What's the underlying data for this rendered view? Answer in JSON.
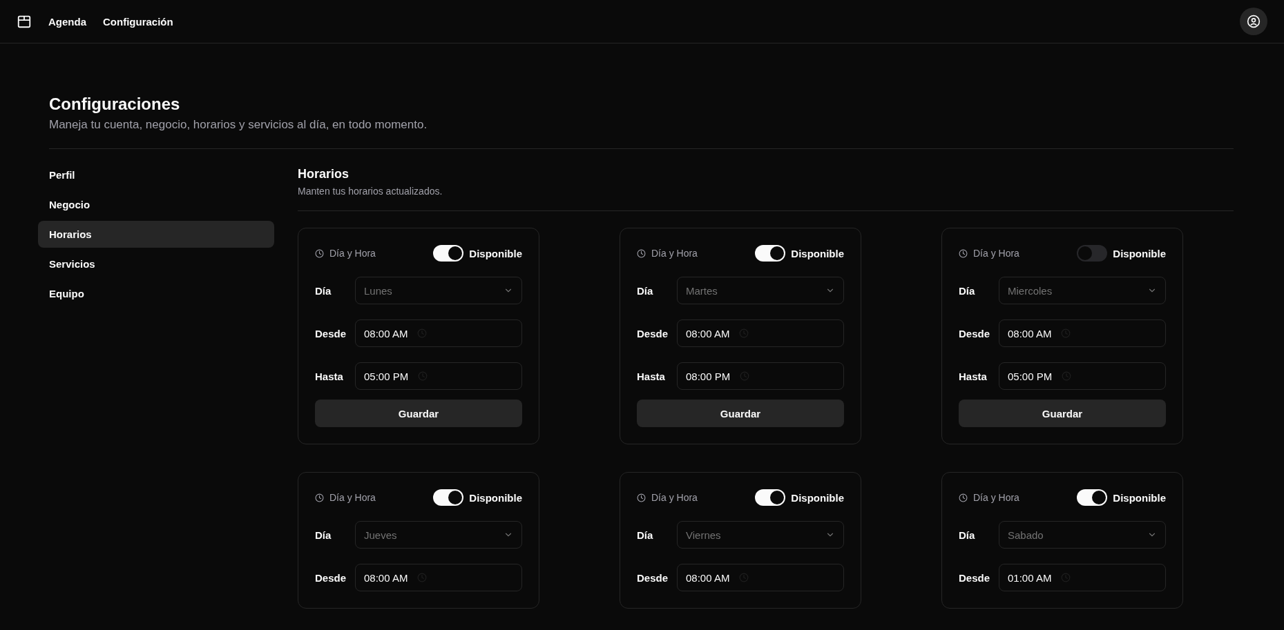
{
  "nav": {
    "links": [
      {
        "label": "Agenda"
      },
      {
        "label": "Configuración"
      }
    ]
  },
  "page": {
    "title": "Configuraciones",
    "subtitle": "Maneja tu cuenta, negocio, horarios y servicios al día, en todo momento."
  },
  "sidebar": {
    "items": [
      {
        "label": "Perfil",
        "selected": false
      },
      {
        "label": "Negocio",
        "selected": false
      },
      {
        "label": "Horarios",
        "selected": true
      },
      {
        "label": "Servicios",
        "selected": false
      },
      {
        "label": "Equipo",
        "selected": false
      }
    ]
  },
  "section": {
    "title": "Horarios",
    "subtitle": "Manten tus horarios actualizados."
  },
  "schedules": [
    {
      "heading": "Día y Hora",
      "available_label": "Disponible",
      "available": true,
      "fields": [
        {
          "kind": "select",
          "label": "Día",
          "value": "Lunes"
        },
        {
          "kind": "time",
          "label": "Desde",
          "value": "08:00 AM"
        },
        {
          "kind": "time",
          "label": "Hasta",
          "value": "05:00 PM"
        }
      ],
      "button": "Guardar"
    },
    {
      "heading": "Día y Hora",
      "available_label": "Disponible",
      "available": true,
      "fields": [
        {
          "kind": "select",
          "label": "Día",
          "value": "Martes"
        },
        {
          "kind": "time",
          "label": "Desde",
          "value": "08:00 AM"
        },
        {
          "kind": "time",
          "label": "Hasta",
          "value": "08:00 PM"
        }
      ],
      "button": "Guardar"
    },
    {
      "heading": "Día y Hora",
      "available_label": "Disponible",
      "available": false,
      "fields": [
        {
          "kind": "select",
          "label": "Día",
          "value": "Miercoles"
        },
        {
          "kind": "time",
          "label": "Desde",
          "value": "08:00 AM"
        },
        {
          "kind": "time",
          "label": "Hasta",
          "value": "05:00 PM"
        }
      ],
      "button": "Guardar"
    },
    {
      "heading": "Día y Hora",
      "available_label": "Disponible",
      "available": true,
      "fields": [
        {
          "kind": "select",
          "label": "Día",
          "value": "Jueves"
        },
        {
          "kind": "time",
          "label": "Desde",
          "value": "08:00 AM"
        }
      ]
    },
    {
      "heading": "Día y Hora",
      "available_label": "Disponible",
      "available": true,
      "fields": [
        {
          "kind": "select",
          "label": "Día",
          "value": "Viernes"
        },
        {
          "kind": "time",
          "label": "Desde",
          "value": "08:00 AM"
        }
      ]
    },
    {
      "heading": "Día y Hora",
      "available_label": "Disponible",
      "available": true,
      "fields": [
        {
          "kind": "select",
          "label": "Día",
          "value": "Sabado"
        },
        {
          "kind": "time",
          "label": "Desde",
          "value": "01:00 AM"
        }
      ]
    }
  ]
}
